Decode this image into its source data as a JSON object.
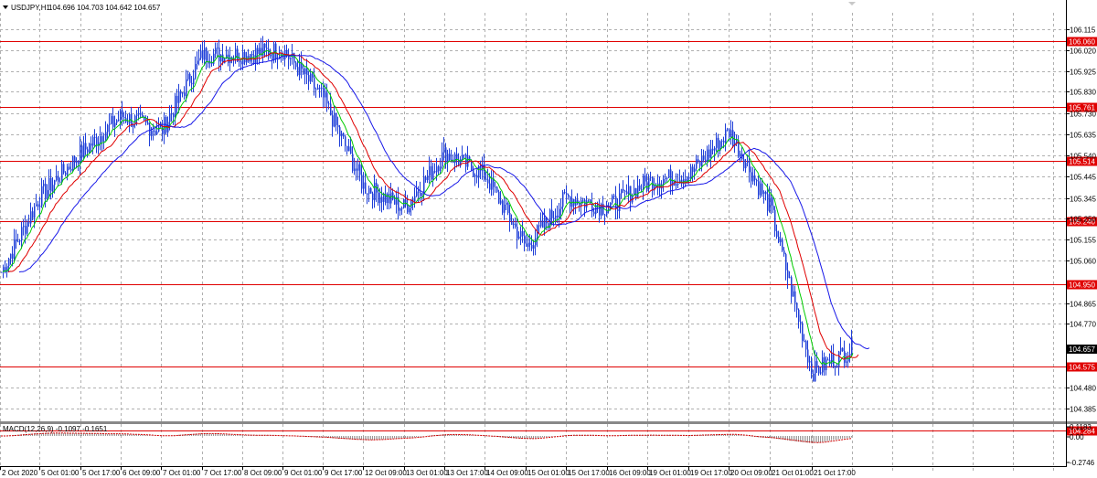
{
  "window": {
    "title": "USDJPY,H1",
    "ohlc": "104.696 104.703 104.642 104.657"
  },
  "colors": {
    "background": "#ffffff",
    "candle": "#1f3fd8",
    "ma_fast": "#00cc00",
    "ma_mid": "#e00000",
    "ma_slow": "#1818e8",
    "level": "#e00000",
    "grid": "#b0b0b0",
    "macd_hist": "#9a9a9a",
    "macd_signal": "#d00000"
  },
  "chart_data": {
    "type": "candlestick",
    "symbol": "USDJPY",
    "timeframe": "H1",
    "ylim": [
      104.33,
      106.19
    ],
    "y_ticks": [
      "106.115",
      "106.020",
      "105.925",
      "105.830",
      "105.730",
      "105.635",
      "105.540",
      "105.445",
      "105.345",
      "105.250",
      "105.155",
      "105.060",
      "104.865",
      "104.770",
      "104.480",
      "104.385"
    ],
    "x_ticks": [
      "2 Oct 2020",
      "5 Oct 01:00",
      "5 Oct 17:00",
      "6 Oct 09:00",
      "7 Oct 01:00",
      "7 Oct 17:00",
      "8 Oct 09:00",
      "9 Oct 01:00",
      "9 Oct 17:00",
      "12 Oct 09:00",
      "13 Oct 01:00",
      "13 Oct 17:00",
      "14 Oct 09:00",
      "15 Oct 01:00",
      "15 Oct 17:00",
      "16 Oct 09:00",
      "19 Oct 01:00",
      "19 Oct 17:00",
      "20 Oct 09:00",
      "21 Oct 01:00",
      "21 Oct 17:00"
    ],
    "levels": [
      "106.060",
      "105.761",
      "105.514",
      "105.240",
      "104.950",
      "104.575",
      "104.284"
    ],
    "current_price": "104.657",
    "price_path": [
      {
        "x": "2 Oct 2020",
        "y": 105.0
      },
      {
        "x": "5 Oct 01:00",
        "y": 105.35
      },
      {
        "x": "5 Oct 17:00",
        "y": 105.55
      },
      {
        "x": "6 Oct 09:00",
        "y": 105.72
      },
      {
        "x": "7 Oct 01:00",
        "y": 105.65
      },
      {
        "x": "7 Oct 17:00",
        "y": 106.0
      },
      {
        "x": "8 Oct 09:00",
        "y": 106.0
      },
      {
        "x": "9 Oct 01:00",
        "y": 106.02
      },
      {
        "x": "9 Oct 17:00",
        "y": 105.8
      },
      {
        "x": "12 Oct 09:00",
        "y": 105.4
      },
      {
        "x": "13 Oct 01:00",
        "y": 105.3
      },
      {
        "x": "13 Oct 17:00",
        "y": 105.55
      },
      {
        "x": "14 Oct 09:00",
        "y": 105.45
      },
      {
        "x": "15 Oct 01:00",
        "y": 105.12
      },
      {
        "x": "15 Oct 17:00",
        "y": 105.35
      },
      {
        "x": "16 Oct 09:00",
        "y": 105.3
      },
      {
        "x": "19 Oct 01:00",
        "y": 105.42
      },
      {
        "x": "19 Oct 17:00",
        "y": 105.45
      },
      {
        "x": "20 Oct 09:00",
        "y": 105.65
      },
      {
        "x": "21 Oct 01:00",
        "y": 105.3
      },
      {
        "x": "21 Oct 17:00",
        "y": 104.55
      },
      {
        "x": "21 Oct 17:00",
        "y": 104.66
      }
    ],
    "indicator": {
      "label": "MACD(12,26,9) -0.1097 -0.1651",
      "ticks": [
        "0.1183",
        "0.00",
        "-0.2746"
      ]
    }
  }
}
